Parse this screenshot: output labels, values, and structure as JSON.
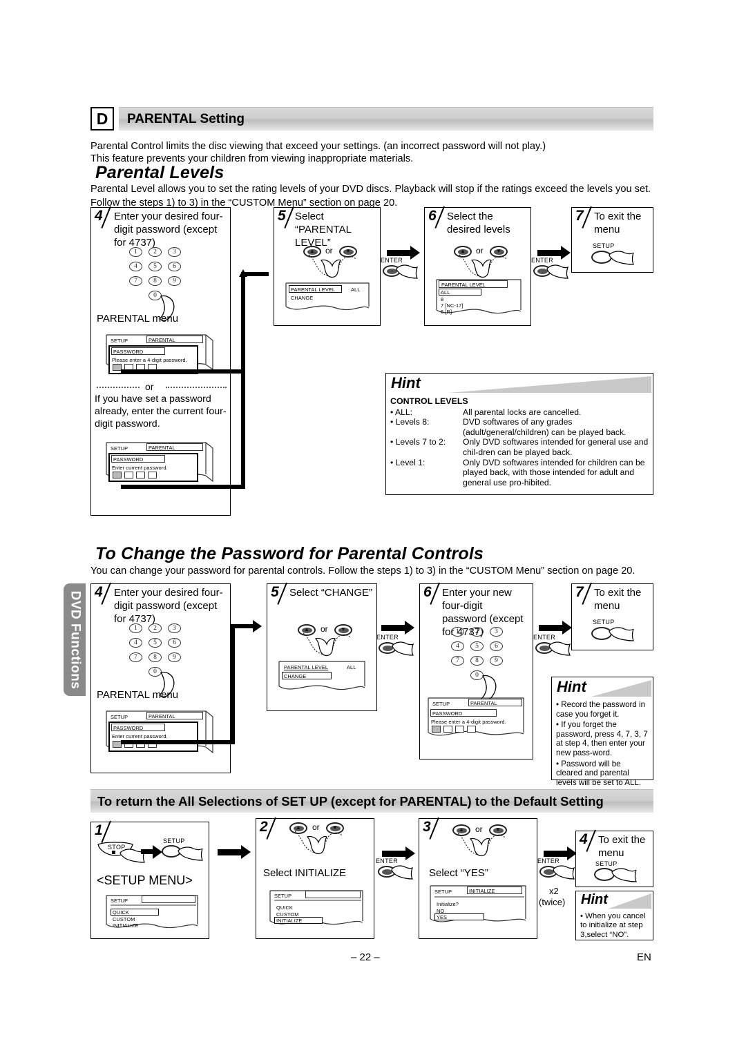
{
  "page": {
    "number": "– 22 –",
    "lang": "EN",
    "side_tab": "DVD Functions"
  },
  "section_d": {
    "letter": "D",
    "title": "PARENTAL Setting",
    "intro_line1": "Parental Control limits the disc viewing that exceed your settings. (an incorrect password will not play.)",
    "intro_line2": "This feature prevents your children from viewing inappropriate materials.",
    "subhead": "Parental Levels",
    "sub_para": "Parental Level allows you to set the rating levels of your DVD discs. Playback will stop if the ratings exceed the levels you set. Follow the steps 1) to 3) in the “CUSTOM Menu” section on page 20."
  },
  "keypad": {
    "keys": [
      "1",
      "2",
      "3",
      "4",
      "5",
      "6",
      "7",
      "8",
      "9",
      "0"
    ]
  },
  "buttons": {
    "enter": "ENTER",
    "setup": "SETUP",
    "stop": "STOP",
    "up": "▲",
    "down": "▼",
    "or": "or"
  },
  "levels_steps": [
    {
      "num": "4",
      "text": "Enter your desired four-digit password (except for 4737)",
      "menu_caption": "PARENTAL menu",
      "or_divider": "or",
      "alt_text": "If you have set a password already, enter the current four-digit password.",
      "osd_top": {
        "title": "SETUP",
        "tab": "PARENTAL",
        "field": "PASSWORD",
        "prompt": "Please enter a 4-digit password."
      },
      "osd_bottom": {
        "title": "SETUP",
        "tab": "PARENTAL",
        "field": "PASSWORD",
        "prompt": "Enter current password."
      }
    },
    {
      "num": "5",
      "text": "Select “PARENTAL LEVEL”",
      "osd": {
        "row1": "PARENTAL LEVEL",
        "row1_value": "ALL",
        "row2": "CHANGE"
      }
    },
    {
      "num": "6",
      "text": "Select the desired levels",
      "osd": {
        "title": "PARENTAL LEVEL",
        "items": [
          "ALL",
          "8",
          "7 [NC-17]",
          "6 [R]"
        ]
      }
    },
    {
      "num": "7",
      "text": "To exit the menu"
    }
  ],
  "hint_levels": {
    "title": "Hint",
    "subtitle": "CONTROL LEVELS",
    "rows": [
      {
        "key": "• ALL:",
        "val": "All parental locks are cancelled."
      },
      {
        "key": "• Levels 8:",
        "val": "DVD softwares of any grades (adult/general/children) can be played back."
      },
      {
        "key": "• Levels 7 to 2:",
        "val": "Only DVD softwares intended for general use and chil-dren can be played back."
      },
      {
        "key": "• Level 1:",
        "val": "Only DVD softwares intended for children can be played back, with those intended for adult and general use pro-hibited."
      }
    ]
  },
  "change_pw": {
    "subhead": "To Change the Password for Parental Controls",
    "para": "You can change your password for parental controls.  Follow the steps 1) to 3) in the “CUSTOM Menu” section on page 20.",
    "steps": [
      {
        "num": "4",
        "text": "Enter your desired four-digit password (except for 4737)",
        "menu_caption": "PARENTAL menu",
        "osd": {
          "title": "SETUP",
          "tab": "PARENTAL",
          "field": "PASSWORD",
          "prompt": "Enter current password."
        }
      },
      {
        "num": "5",
        "text": "Select “CHANGE”",
        "osd": {
          "row1": "PARENTAL LEVEL",
          "row1_value": "ALL",
          "row2": "CHANGE"
        }
      },
      {
        "num": "6",
        "text": "Enter your new four-digit password (except for 4737)",
        "osd": {
          "title": "SETUP",
          "tab": "PARENTAL",
          "field": "PASSWORD",
          "prompt": "Please enter a 4-digit password."
        }
      },
      {
        "num": "7",
        "text": "To exit the menu"
      }
    ],
    "hint": {
      "title": "Hint",
      "items": [
        "• Record the password in case you forget it.",
        "• If you forget the password, press 4, 7, 3, 7 at step 4, then enter your new pass-word.",
        "• Password will be cleared and parental levels will be set to ALL."
      ]
    }
  },
  "initialize": {
    "bar_title": "To return the All Selections of SET UP (except for PARENTAL) to the Default Setting",
    "steps": [
      {
        "num": "1",
        "caption": "<SETUP MENU>",
        "osd": {
          "title": "SETUP",
          "items": [
            "QUICK",
            "CUSTOM",
            "INITIALIZE"
          ],
          "selected": "QUICK"
        }
      },
      {
        "num": "2",
        "caption": "Select INITIALIZE",
        "osd": {
          "title": "SETUP",
          "items": [
            "QUICK",
            "CUSTOM",
            "INITIALIZE"
          ],
          "selected": "INITIALIZE"
        }
      },
      {
        "num": "3",
        "caption": "Select “YES”",
        "osd": {
          "title": "SETUP",
          "tab": "INITIALIZE",
          "prompt": "Initialize?",
          "items": [
            "NO",
            "YES"
          ],
          "selected": "YES"
        }
      },
      {
        "num": "4",
        "text": "To exit the menu"
      }
    ],
    "twice_line1": "x2",
    "twice_line2": "(twice)",
    "hint": {
      "title": "Hint",
      "items": [
        "• When you cancel to initialize at step 3,select “NO”."
      ]
    }
  }
}
